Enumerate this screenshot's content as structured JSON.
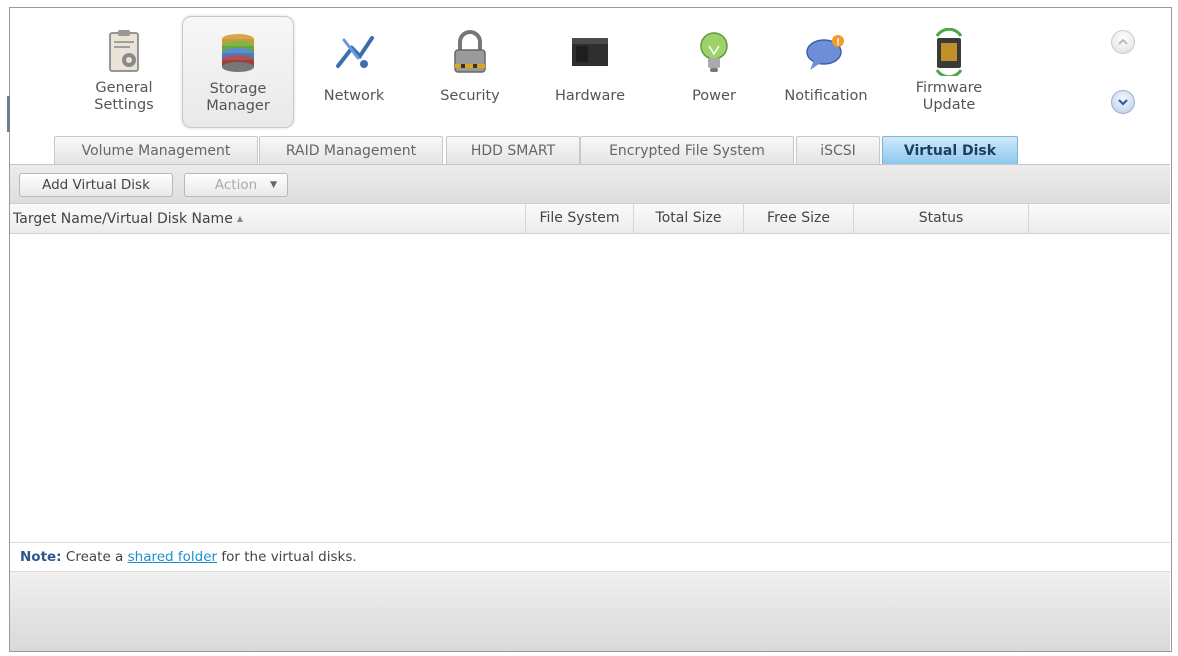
{
  "menu": {
    "items": [
      {
        "label": "General\nSettings",
        "icon": "settings-clipboard-icon"
      },
      {
        "label": "Storage\nManager",
        "icon": "storage-disks-icon",
        "selected": true
      },
      {
        "label": "Network",
        "icon": "network-icon"
      },
      {
        "label": "Security",
        "icon": "padlock-icon"
      },
      {
        "label": "Hardware",
        "icon": "hardware-icon"
      },
      {
        "label": "Power",
        "icon": "lightbulb-icon"
      },
      {
        "label": "Notification",
        "icon": "speech-bubble-icon"
      },
      {
        "label": "Firmware\nUpdate",
        "icon": "chip-update-icon"
      }
    ]
  },
  "tabs": [
    {
      "label": "Volume Management"
    },
    {
      "label": "RAID Management"
    },
    {
      "label": "HDD SMART"
    },
    {
      "label": "Encrypted File System"
    },
    {
      "label": "iSCSI"
    },
    {
      "label": "Virtual Disk",
      "active": true
    }
  ],
  "toolbar": {
    "add_label": "Add Virtual Disk",
    "action_label": "Action"
  },
  "table": {
    "columns": [
      "Target Name/Virtual Disk Name",
      "File System",
      "Total Size",
      "Free Size",
      "Status"
    ],
    "rows": []
  },
  "note": {
    "prefix": "Note:",
    "text_before": "Create a",
    "link": "shared folder",
    "text_after": "for the virtual disks."
  },
  "colors": {
    "active_tab": "#8fc7ee",
    "link": "#1d8fd0"
  }
}
